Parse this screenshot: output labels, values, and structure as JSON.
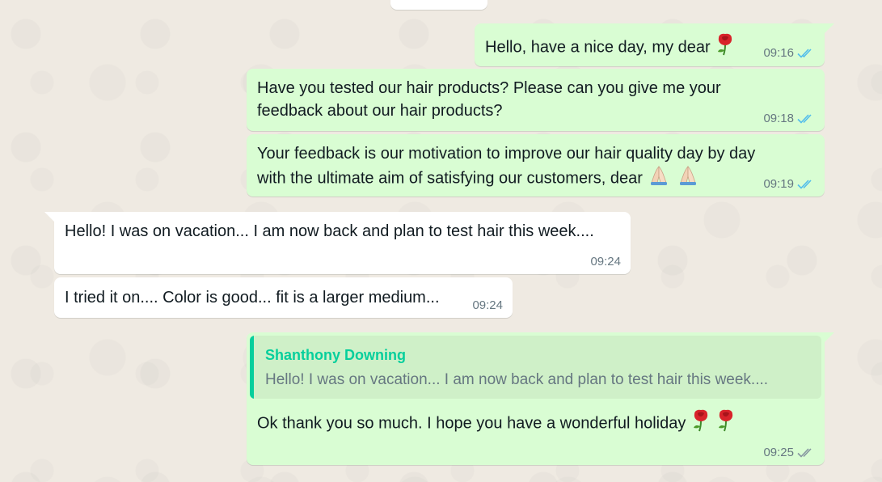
{
  "messages": [
    {
      "direction": "outgoing",
      "lines": [
        "Hello, have a nice day, my dear"
      ],
      "emoji": [
        "rose-emoji"
      ],
      "time": "09:16",
      "status": "read"
    },
    {
      "direction": "outgoing",
      "lines": [
        "Have you tested our hair products? Please can you give me your",
        "feedback about our hair products?"
      ],
      "time": "09:18",
      "status": "read"
    },
    {
      "direction": "outgoing",
      "lines": [
        "Your feedback is our motivation to improve our hair quality day by day",
        "with the ultimate aim of satisfying our customers, dear"
      ],
      "emoji": [
        "folded-hands-emoji",
        "folded-hands-emoji"
      ],
      "time": "09:19",
      "status": "read"
    },
    {
      "direction": "incoming",
      "lines": [
        "Hello! I was on vacation... I am now back and plan to test hair this week...."
      ],
      "time": "09:24"
    },
    {
      "direction": "incoming",
      "lines": [
        "I tried it on.... Color is good... fit is a larger medium..."
      ],
      "time": "09:24"
    },
    {
      "direction": "outgoing",
      "reply_to": {
        "author": "Shanthony Downing",
        "text": "Hello! I was on vacation... I am now back and plan to test hair this week...."
      },
      "lines": [
        "Ok thank you so much. I hope you have a wonderful holiday"
      ],
      "emoji": [
        "rose-emoji",
        "rose-emoji"
      ],
      "time": "09:25",
      "status": "delivered"
    }
  ],
  "colors": {
    "outgoing_bubble": "#d9fdd3",
    "incoming_bubble": "#ffffff",
    "read_ticks": "#53bdeb",
    "delivered_ticks": "#8696a0",
    "quote_accent": "#06cf9c",
    "chat_background": "#efeae2"
  }
}
